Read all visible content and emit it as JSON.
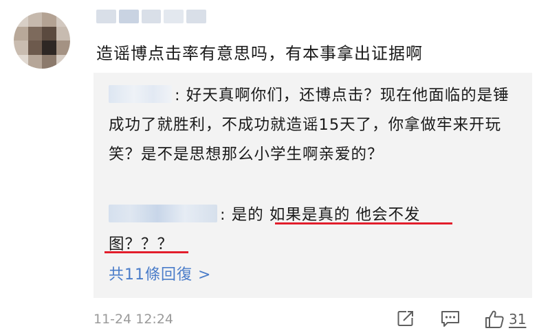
{
  "comment": {
    "text": "造谣博点击率有意思吗，有本事拿出证据啊",
    "timestamp": "11-24 12:24",
    "like_count": "31"
  },
  "replies": [
    {
      "separator": ": ",
      "text": "好天真啊你们，还博点击？现在他面临的是锤成功了就胜利，不成功就造谣15天了，你拿做牢来开玩笑？是不是思想那么小学生啊亲爱的？"
    },
    {
      "separator": ": ",
      "text": "是的 如果是真的 他会不发图？？？"
    }
  ],
  "more_replies_label": "共11條回復 >",
  "icons": {
    "share": "share-icon",
    "comment": "comment-icon",
    "like": "thumbs-up-icon"
  },
  "colors": {
    "link": "#4a7cc9",
    "highlight_underline": "#e21d2b",
    "reply_background": "#f3f3f3",
    "meta_text": "#9a9a9a"
  }
}
